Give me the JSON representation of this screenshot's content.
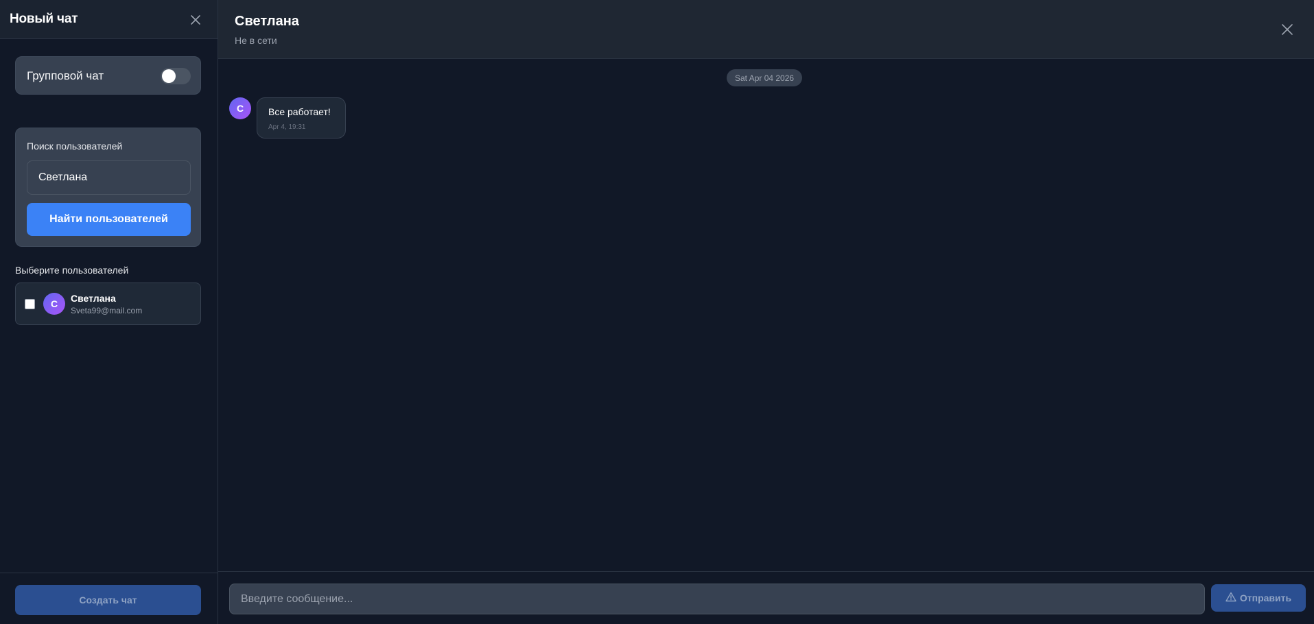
{
  "new_chat": {
    "title": "Новый чат",
    "close_icon": "close-icon",
    "group_chat_label": "Групповой чат",
    "group_chat_enabled": false,
    "search_label": "Поиск пользователей",
    "search_value": "Светлана",
    "search_button": "Найти пользователей",
    "select_label": "Выберите пользователей",
    "users": [
      {
        "initial": "С",
        "name": "Светлана",
        "email": "Sveta99@mail.com",
        "checked": false
      }
    ],
    "create_button": "Создать чат"
  },
  "chat": {
    "name": "Светлана",
    "status": "Не в сети",
    "close_icon": "close-icon",
    "date_divider": "Sat Apr 04 2026",
    "messages": [
      {
        "avatar_initial": "С",
        "text": "Все работает!",
        "time": "Apr 4, 19:31"
      }
    ],
    "input_placeholder": "Введите сообщение...",
    "send_button": "Отправить",
    "send_icon": "warning-icon"
  },
  "colors": {
    "accent": "#3b82f6",
    "accent_disabled": "#2b4f91",
    "background": "#111827",
    "panel": "#374151"
  }
}
